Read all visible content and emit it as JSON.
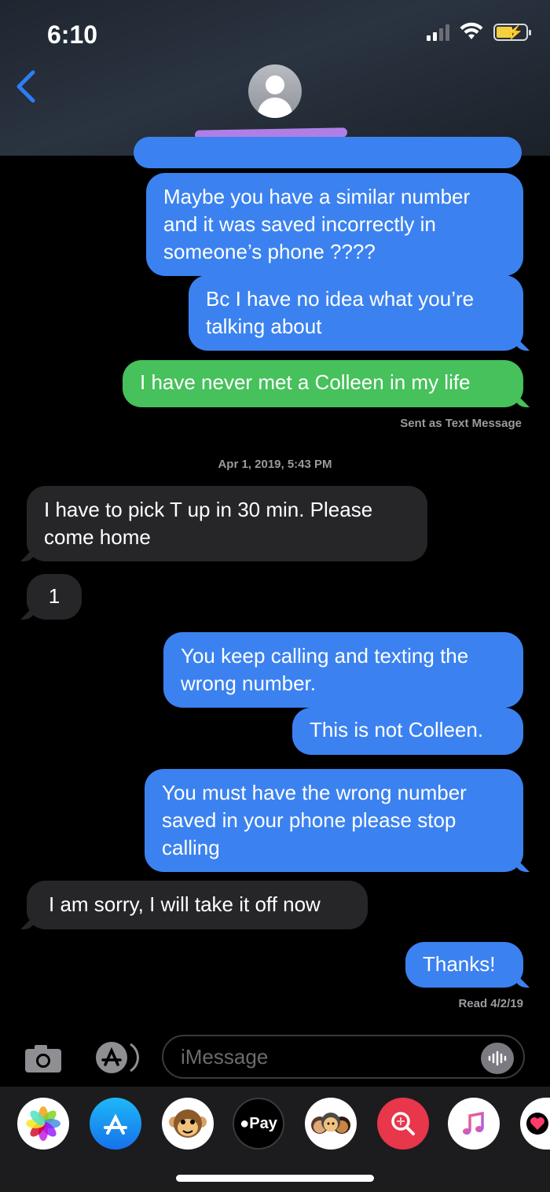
{
  "status_bar": {
    "time": "6:10"
  },
  "header": {
    "back_label": ""
  },
  "messages": [
    {
      "kind": "sent",
      "text": "Maybe you have a similar number and it was saved incorrectly in someone’s phone ????"
    },
    {
      "kind": "sent",
      "text": "Bc I have no idea what you’re talking about"
    },
    {
      "kind": "sms",
      "text": "I have never met a Colleen in my life"
    },
    {
      "kind": "received",
      "text": "I have to pick T up in 30 min. Please come home"
    },
    {
      "kind": "received",
      "text": "1"
    },
    {
      "kind": "sent",
      "text": "You keep calling and texting the wrong number."
    },
    {
      "kind": "sent",
      "text": "This is not Colleen."
    },
    {
      "kind": "sent",
      "text": "You must have the wrong number saved in your phone please stop calling"
    },
    {
      "kind": "received",
      "text": "I am sorry, I will take it off now"
    },
    {
      "kind": "sent",
      "text": "Thanks!"
    }
  ],
  "sent_as_text": "Sent as Text Message",
  "timestamp": "Apr 1, 2019, 5:43 PM",
  "read_receipt": "Read 4/2/19",
  "input": {
    "placeholder": "iMessage"
  },
  "app_drawer": {
    "apps": [
      {
        "name": "photos-icon"
      },
      {
        "name": "app-store-icon"
      },
      {
        "name": "animoji-icon"
      },
      {
        "name": "apple-pay-icon",
        "label": "Pay"
      },
      {
        "name": "memoji-icon"
      },
      {
        "name": "images-search-icon"
      },
      {
        "name": "music-icon"
      },
      {
        "name": "digital-touch-icon"
      }
    ]
  },
  "colors": {
    "sent_bubble": "#3b82f0",
    "sms_bubble": "#46c15b",
    "received_bubble": "#262629",
    "link_blue": "#2f7cf6"
  }
}
